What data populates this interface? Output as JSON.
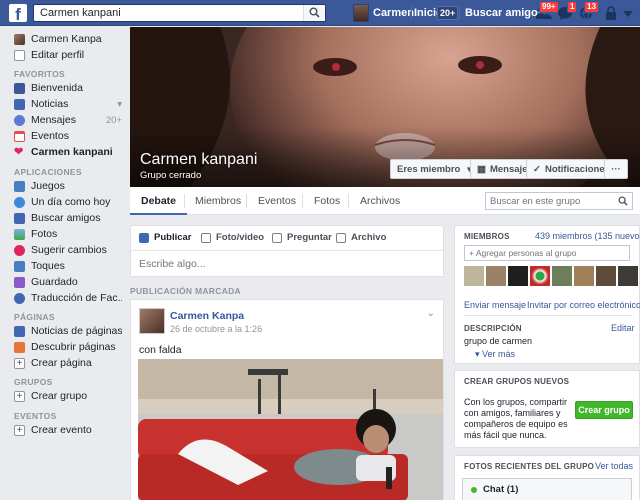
{
  "colors": {
    "brand": "#3b5998",
    "link": "#365899",
    "green": "#42b72a",
    "badge": "#fa3e3e"
  },
  "topbar": {
    "search_value": "Carmen kanpani",
    "user_name": "Carmen",
    "home_label": "Inicio",
    "home_count": "20+",
    "find_friends": "Buscar amigos",
    "friend_requests_badge": "99+",
    "messages_badge": "1",
    "notifications_badge": "13"
  },
  "sidebar": {
    "profile": [
      {
        "label": "Carmen Kanpa",
        "icon": "avatar"
      },
      {
        "label": "Editar perfil",
        "icon": "pencil-icon"
      }
    ],
    "favorites_title": "FAVORITOS",
    "favorites": [
      {
        "label": "Bienvenida",
        "icon": "facebook-icon",
        "count": ""
      },
      {
        "label": "Noticias",
        "icon": "news-feed-icon",
        "count": ""
      },
      {
        "label": "Mensajes",
        "icon": "messages-icon",
        "count": "20+"
      },
      {
        "label": "Eventos",
        "icon": "calendar-icon",
        "count": ""
      },
      {
        "label": "Carmen kanpani",
        "icon": "heart-icon",
        "count": ""
      }
    ],
    "apps_title": "APLICACIONES",
    "apps": [
      {
        "label": "Juegos",
        "icon": "games-icon"
      },
      {
        "label": "Un día como hoy",
        "icon": "clock-icon"
      },
      {
        "label": "Buscar amigos",
        "icon": "friends-icon"
      },
      {
        "label": "Fotos",
        "icon": "photos-icon"
      },
      {
        "label": "Sugerir cambios",
        "icon": "bulb-icon"
      },
      {
        "label": "Toques",
        "icon": "poke-icon"
      },
      {
        "label": "Guardado",
        "icon": "bookmark-icon"
      },
      {
        "label": "Traducción de Fac...",
        "icon": "translate-icon"
      }
    ],
    "pages_title": "PÁGINAS",
    "pages": [
      {
        "label": "Noticias de páginas",
        "icon": "pages-feed-icon"
      },
      {
        "label": "Descubrir páginas",
        "icon": "flag-icon"
      },
      {
        "label": "Crear página",
        "icon": "plus-icon"
      }
    ],
    "groups_title": "GRUPOS",
    "groups": [
      {
        "label": "Crear grupo",
        "icon": "plus-icon"
      }
    ],
    "events_title": "EVENTOS",
    "events": [
      {
        "label": "Crear evento",
        "icon": "plus-icon"
      }
    ]
  },
  "group": {
    "name": "Carmen kanpani",
    "type": "Grupo cerrado",
    "member_btn": "Eres miembro",
    "message_btn": "Mensaje",
    "notifications_btn": "Notificaciones",
    "more_btn": "···"
  },
  "tabs": [
    "Debate",
    "Miembros",
    "Eventos",
    "Fotos",
    "Archivos"
  ],
  "group_search_placeholder": "Buscar en este grupo",
  "composer": {
    "tabs": [
      "Publicar",
      "Foto/video",
      "Preguntar",
      "Archivo"
    ],
    "placeholder": "Escribe algo..."
  },
  "pinned_label": "PUBLICACIÓN MARCADA",
  "post": {
    "author": "Carmen Kanpa",
    "time": "26 de octubre a la 1:26",
    "text": "con falda"
  },
  "members": {
    "title": "MIEMBROS",
    "count": "439 miembros (135 nuevos)",
    "add_placeholder": "+ Agregar personas al grupo",
    "send_message": "Enviar mensaje",
    "invite_email": "Invitar por correo electrónico",
    "description_title": "DESCRIPCIÓN",
    "edit": "Editar",
    "description": "grupo de carmen",
    "see_more": "Ver más"
  },
  "create_groups": {
    "title": "CREAR GRUPOS NUEVOS",
    "line1": "Con los grupos, compartir",
    "line2": "con amigos, familiares y",
    "line3": "compañeros de equipo es",
    "line4": "más fácil que nunca.",
    "button": "Crear grupo"
  },
  "recent_photos": {
    "title": "FOTOS RECIENTES DEL GRUPO",
    "see_all": "Ver todas"
  },
  "chat": {
    "label": "Chat (1)"
  }
}
